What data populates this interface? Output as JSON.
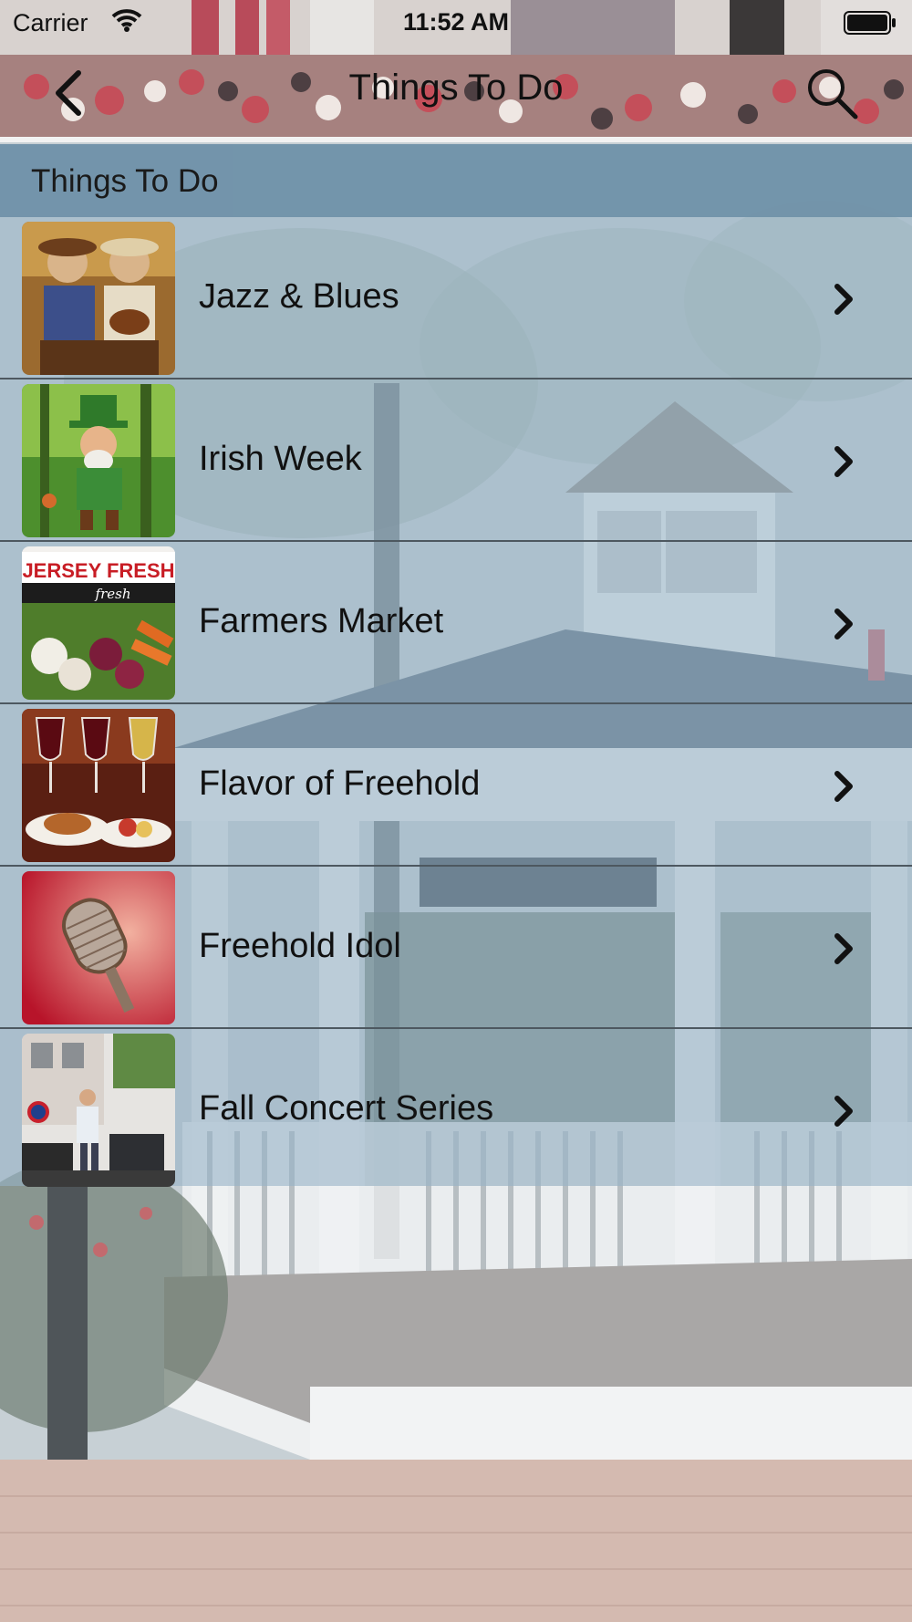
{
  "status_bar": {
    "carrier": "Carrier",
    "time": "11:52 AM",
    "icons": [
      "wifi-icon",
      "battery-icon"
    ]
  },
  "nav": {
    "title": "Things To Do",
    "icons": [
      "chevron-left-icon",
      "search-icon"
    ]
  },
  "section": {
    "title": "Things To Do"
  },
  "items": [
    {
      "label": "Jazz & Blues",
      "thumb": "two-musicians-painting"
    },
    {
      "label": "Irish Week",
      "thumb": "leprechaun-in-forest"
    },
    {
      "label": "Farmers Market",
      "thumb": "jersey-fresh-vegetables",
      "thumb_text": {
        "brand": "JERSEY FRESH",
        "sub": "fresh"
      }
    },
    {
      "label": "Flavor of Freehold",
      "thumb": "wine-and-food"
    },
    {
      "label": "Freehold Idol",
      "thumb": "vintage-microphone"
    },
    {
      "label": "Fall Concert Series",
      "thumb": "street-band-stage"
    }
  ],
  "colors": {
    "section_header": "#6f91a9",
    "row_overlay": "#96b2c6",
    "separator": "#4d5860"
  }
}
